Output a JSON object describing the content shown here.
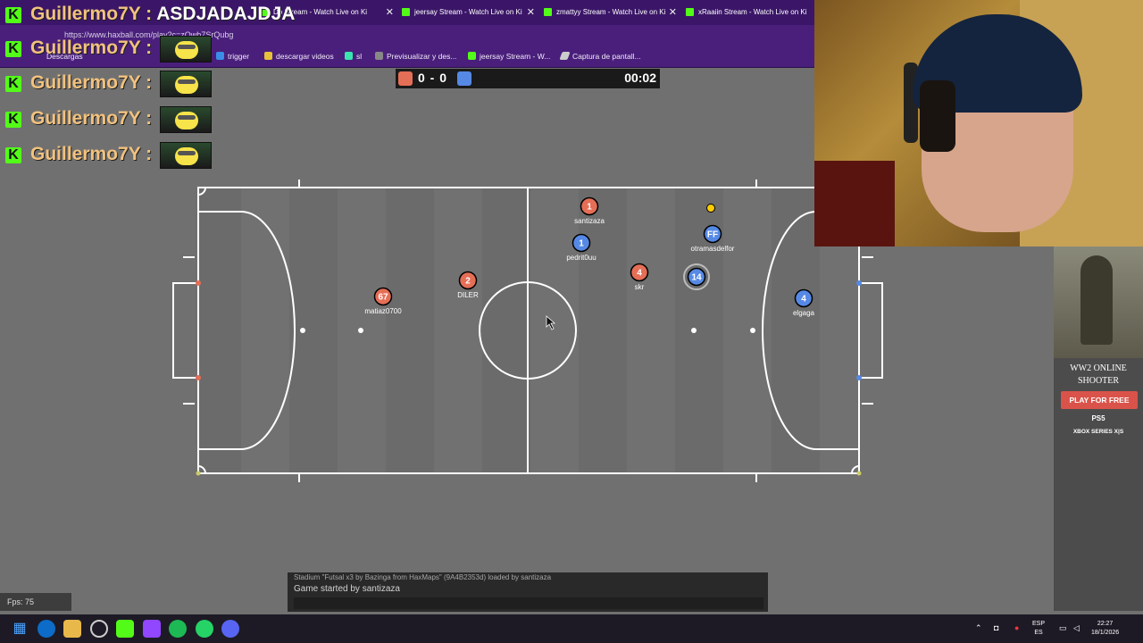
{
  "browser": {
    "tabs": [
      {
        "label": "Do Stream - Watch Live on Ki"
      },
      {
        "label": "jeersay Stream - Watch Live on Ki"
      },
      {
        "label": "zmattyy Stream - Watch Live on Ki"
      },
      {
        "label": "xRaaiin Stream - Watch Live on Ki"
      }
    ],
    "tab_close": "✕",
    "url": "https://www.haxball.com/play?c=zOwb7SrQubg",
    "bookmarks": [
      {
        "label": "Descargas"
      },
      {
        "label": "trigger"
      },
      {
        "label": "descargar videos"
      },
      {
        "label": "sl"
      },
      {
        "label": "Previsualizar y des..."
      },
      {
        "label": "jeersay Stream - W..."
      },
      {
        "label": "Captura de pantall..."
      }
    ]
  },
  "chat_overlay": [
    {
      "user": "Guillermo7Y",
      "sep": ":",
      "message": "ASDJADAJDJA"
    },
    {
      "user": "Guillermo7Y",
      "sep": ":",
      "message": ""
    },
    {
      "user": "Guillermo7Y",
      "sep": ":",
      "message": ""
    },
    {
      "user": "Guillermo7Y",
      "sep": ":",
      "message": ""
    },
    {
      "user": "Guillermo7Y",
      "sep": ":",
      "message": ""
    }
  ],
  "kick_letter": "K",
  "scoreboard": {
    "red_color": "#e56e56",
    "blue_color": "#5689e5",
    "score": "0 - 0",
    "timer": "00:02"
  },
  "game": {
    "players": [
      {
        "team": "red",
        "number": "1",
        "name": "santizaza"
      },
      {
        "team": "red",
        "number": "2",
        "name": "DILER"
      },
      {
        "team": "red",
        "number": "67",
        "name": "matiaz0700"
      },
      {
        "team": "red",
        "number": "4",
        "name": "skr"
      },
      {
        "team": "blue",
        "number": "1",
        "name": "pedrit0uu"
      },
      {
        "team": "blue",
        "number": "FF",
        "name": "otramasdelfor"
      },
      {
        "team": "blue",
        "number": "14",
        "name": ""
      },
      {
        "team": "blue",
        "number": "4",
        "name": "elgaga"
      }
    ],
    "ball_color": "#ffcc00"
  },
  "chatbox": {
    "log_line_1": "Stadium \"Futsal x3 by Bazinga from HaxMaps\" (9A4B2353d) loaded by santizaza",
    "log_line_2": "Game started by santizaza",
    "input_value": ""
  },
  "fps": "Fps: 75",
  "ad": {
    "title": "WW2 ONLINE SHOOTER",
    "button": "PLAY FOR FREE",
    "ps5": "PS5",
    "xbox": "XBOX SERIES X|S"
  },
  "taskbar": {
    "lang_top": "ESP",
    "lang_bottom": "ES",
    "time": "22:27",
    "date": "18/1/2026"
  }
}
